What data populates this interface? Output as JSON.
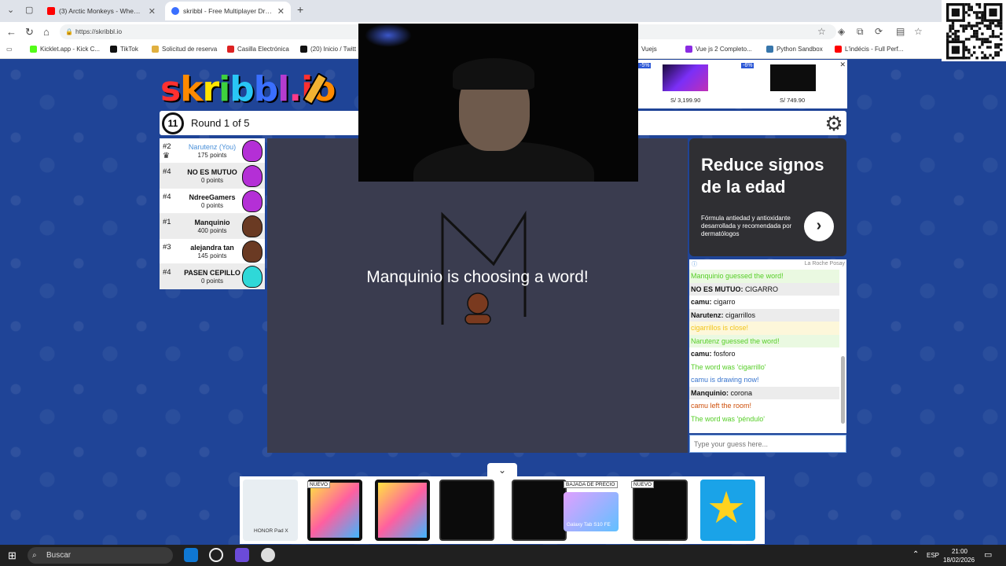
{
  "browser": {
    "tabs": [
      {
        "title": "(3) Arctic Monkeys - When Th",
        "active": false
      },
      {
        "title": "skribbl - Free Multiplayer Drawing",
        "active": true
      }
    ],
    "new_tab": "+",
    "url": "https://skribbl.io",
    "bookmarks": [
      "Kicklet.app - Kick C...",
      "TikTok",
      "Solicitud de reserva",
      "Casilla Electrónica",
      "(20) Inicio / Twitt",
      "Vue js 2 Completo...",
      "Python Sandbox",
      "L'indécis - Full Perf..."
    ],
    "bookmark_partial": "Vuejs"
  },
  "game": {
    "logo": [
      "s",
      "k",
      "r",
      "i",
      "b",
      "b",
      "l",
      ".",
      "i",
      "o"
    ],
    "logo_colors": [
      "#ff3030",
      "#ff8a00",
      "#ffe400",
      "#3ed13e",
      "#29c6f5",
      "#3a6fff",
      "#b43ccf",
      "#ff3a8a",
      "#ff3030",
      "#ff8a00"
    ],
    "timer": "11",
    "round": "Round 1 of 5",
    "players": [
      {
        "rank": "#2",
        "name": "Narutenz (You)",
        "points": "175 points",
        "you": true,
        "crown": true,
        "color": "#b42fd6"
      },
      {
        "rank": "#4",
        "name": "NO ES MUTUO",
        "points": "0 points",
        "you": false,
        "crown": false,
        "color": "#b42fd6"
      },
      {
        "rank": "#4",
        "name": "NdreeGamers",
        "points": "0 points",
        "you": false,
        "crown": false,
        "color": "#b42fd6"
      },
      {
        "rank": "#1",
        "name": "Manquinio",
        "points": "400 points",
        "you": false,
        "crown": false,
        "color": "#6a3a23"
      },
      {
        "rank": "#3",
        "name": "alejandra tan",
        "points": "145 points",
        "you": false,
        "crown": false,
        "color": "#6a3a23"
      },
      {
        "rank": "#4",
        "name": "PASEN CEPILLO",
        "points": "0 points",
        "you": false,
        "crown": false,
        "color": "#2fd8d8"
      }
    ],
    "choosing_text": "Manquinio is choosing a word!"
  },
  "chat": {
    "messages": [
      {
        "type": "green",
        "author": "",
        "text": "Manquinio guessed the word!"
      },
      {
        "type": "normal",
        "author": "NO ES MUTUO:",
        "text": " CIGARRO"
      },
      {
        "type": "normal",
        "author": "camu:",
        "text": " cigarro"
      },
      {
        "type": "normal",
        "author": "Narutenz:",
        "text": " cigarrillos"
      },
      {
        "type": "yellow",
        "author": "",
        "text": "cigarrillos is close!"
      },
      {
        "type": "green",
        "author": "",
        "text": "Narutenz guessed the word!"
      },
      {
        "type": "normal",
        "author": "camu:",
        "text": " fosforo"
      },
      {
        "type": "green2",
        "author": "",
        "text": "The word was 'cigarrillo'"
      },
      {
        "type": "blue",
        "author": "",
        "text": "camu is drawing now!"
      },
      {
        "type": "normal",
        "author": "Manquinio:",
        "text": " corona"
      },
      {
        "type": "red",
        "author": "",
        "text": "camu left the room!"
      },
      {
        "type": "green2",
        "author": "",
        "text": "The word was 'péndulo'"
      }
    ],
    "placeholder": "Type your guess here..."
  },
  "ads": {
    "top": {
      "items": [
        {
          "discount": "-5%",
          "price": "S/ 3,199.90"
        },
        {
          "discount": "-6%",
          "price": "S/ 749.90"
        }
      ],
      "close": "✕"
    },
    "side": {
      "headline": "Reduce signos de la edad",
      "body": "Fórmula antiedad y antioxidante desarrollada y recomendada por dermatólogos",
      "arrow": "›",
      "brand": "La Roche Posay"
    },
    "bottom": {
      "badges": [
        "NUEVO",
        "NUEVO",
        "BAJADA DE PRECIO"
      ],
      "honor_label": "HONOR Pad X",
      "galaxy_label": "Galaxy Tab S10 FE"
    }
  },
  "taskbar": {
    "search": "Buscar",
    "lang": "ESP",
    "time": "21:00",
    "date": "18/02/2026"
  }
}
